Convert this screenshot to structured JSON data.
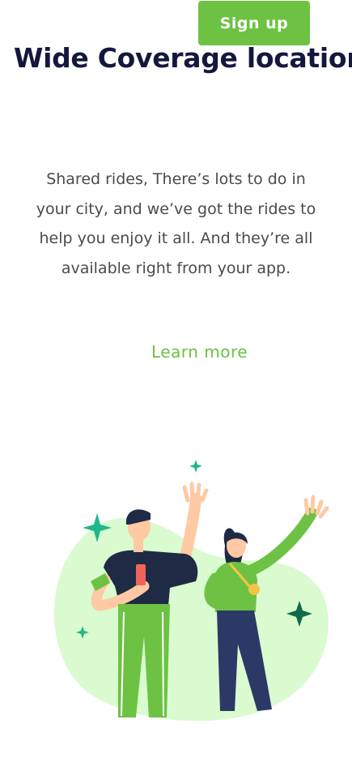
{
  "header": {
    "signup_label": "Sign up"
  },
  "hero": {
    "title": "Wide Coverage location",
    "description": "Shared rides, There’s lots to do in your city, and we’ve got the rides to help you enjoy it all. And they’re all available right from your app.",
    "learn_more_label": "Learn more"
  },
  "colors": {
    "brand_green": "#6dc243",
    "title_navy": "#14183e",
    "body_text": "#4a4a4a",
    "blob_light_green": "#d9fbcf",
    "sparkle_teal": "#1fb88a"
  },
  "illustration": {
    "icon": "celebrating-people-illustration"
  }
}
